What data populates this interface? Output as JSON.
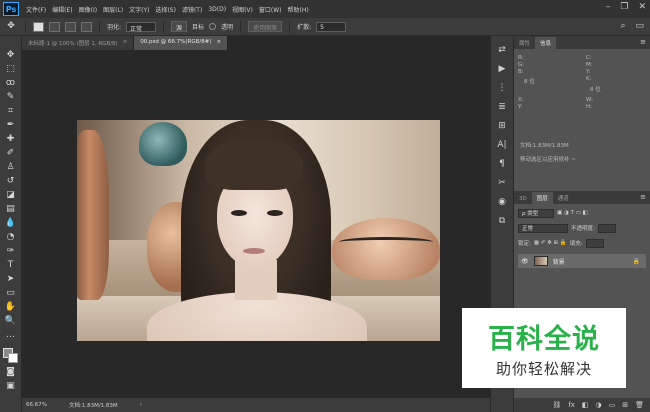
{
  "app": {
    "logo": "Ps"
  },
  "menubar": {
    "items": [
      "文件(F)",
      "编辑(E)",
      "图像(I)",
      "图层(L)",
      "文字(Y)",
      "选择(S)",
      "滤镜(T)",
      "3D(D)",
      "视图(V)",
      "窗口(W)",
      "帮助(H)"
    ]
  },
  "window_controls": {
    "minimize": "–",
    "restore": "❐",
    "close": "✕"
  },
  "options": {
    "feather_label": "羽化:",
    "feather_value": "正常",
    "source_btn": "源",
    "target_btn": "目标",
    "transparent_label": "透明",
    "use_pattern_btn": "使用图案",
    "diffusion_label": "扩散:",
    "diffusion_value": "5",
    "search_icon": "⌕",
    "workspace_icon": "▭"
  },
  "tabs": [
    {
      "label": "未标题-1 @ 100% (图层 1, RGB/8)",
      "close": "×"
    },
    {
      "label": "00.psd @ 66.7%(RGB/8#)",
      "close": "×"
    }
  ],
  "status": {
    "zoom": "66.67%",
    "doc": "文档:1.83M/1.83M",
    "arrow": "›"
  },
  "panels": {
    "top_tabs": [
      "属性",
      "信息"
    ],
    "menu_icon": "≡",
    "info": {
      "rgb_labels": "R:\nG:\nB:",
      "cmyk_labels": "C:\nM:\nY:\nK:",
      "bit_left": "8 位",
      "bit_right": "8 位",
      "xy_labels": "X:\nY:",
      "wh_labels": "W:\nH:",
      "doc": "文档:1.83M/1.83M",
      "hint": "移动选区以应用修补 ~"
    },
    "layer_tabs": [
      "3D",
      "图层",
      "通道"
    ],
    "layers": {
      "kind_label": "ρ 类型",
      "mode": "正常",
      "opacity_label": "不透明度:",
      "lock_label": "锁定:",
      "fill_label": "填充:",
      "layer_name": "背景",
      "lock_icon": "🔒",
      "eye_icon": "👁"
    },
    "bottom_icons": [
      "⛓",
      "fx",
      "◧",
      "◑",
      "▭",
      "⊞",
      "🗑"
    ]
  },
  "dock_icons": [
    "⇄",
    "▶",
    "⋮",
    "≣",
    "⊞",
    "A|",
    "¶",
    "✂",
    "◉",
    "⧉"
  ],
  "watermark": {
    "title": "百科全说",
    "subtitle": "助你轻松解决"
  }
}
